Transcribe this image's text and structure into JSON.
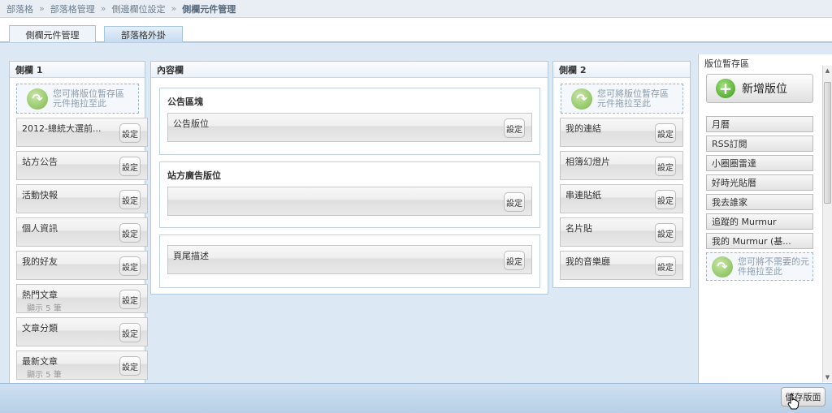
{
  "breadcrumb": [
    "部落格",
    "部落格管理",
    "側邊欄位設定",
    "側欄元件管理"
  ],
  "breadcrumb_separator": "»",
  "tabs": [
    {
      "label": "側欄元件管理",
      "active": true
    },
    {
      "label": "部落格外掛",
      "active": false
    }
  ],
  "sidebar1": {
    "title": "側欄 1",
    "drop_hint": [
      "您可將版位暫存區",
      "元件拖拉至此"
    ],
    "widgets": [
      {
        "label": "2012-總統大選前..."
      },
      {
        "label": "站方公告"
      },
      {
        "label": "活動快報"
      },
      {
        "label": "個人資訊"
      },
      {
        "label": "我的好友"
      },
      {
        "label": "熱門文章",
        "sub": "顯示 5 筆"
      },
      {
        "label": "文章分類"
      },
      {
        "label": "最新文章",
        "sub": "顯示 5 筆"
      }
    ]
  },
  "content": {
    "title": "內容欄",
    "sections": [
      {
        "title": "公告區塊",
        "widget": "公告版位"
      },
      {
        "title": "站方廣告版位",
        "widget": ""
      },
      {
        "title": "",
        "widget": "頁尾描述"
      }
    ]
  },
  "sidebar2": {
    "title": "側欄 2",
    "drop_hint": [
      "您可將版位暫存區",
      "元件拖拉至此"
    ],
    "widgets": [
      {
        "label": "我的連結"
      },
      {
        "label": "相簿幻燈片"
      },
      {
        "label": "串連貼紙"
      },
      {
        "label": "名片貼"
      },
      {
        "label": "我的音樂廳"
      }
    ]
  },
  "staging": {
    "title": "版位暫存區",
    "add_button": "新增版位",
    "items": [
      "月曆",
      "RSS訂閱",
      "小圈圈雷達",
      "好時光貼曆",
      "我去誰家",
      "追蹤的 Murmur",
      "我的 Murmur (基..."
    ],
    "drop_hint": [
      "您可將不需要的元",
      "件拖拉至此"
    ]
  },
  "settings_label": "設定",
  "save_button": "儲存版面"
}
